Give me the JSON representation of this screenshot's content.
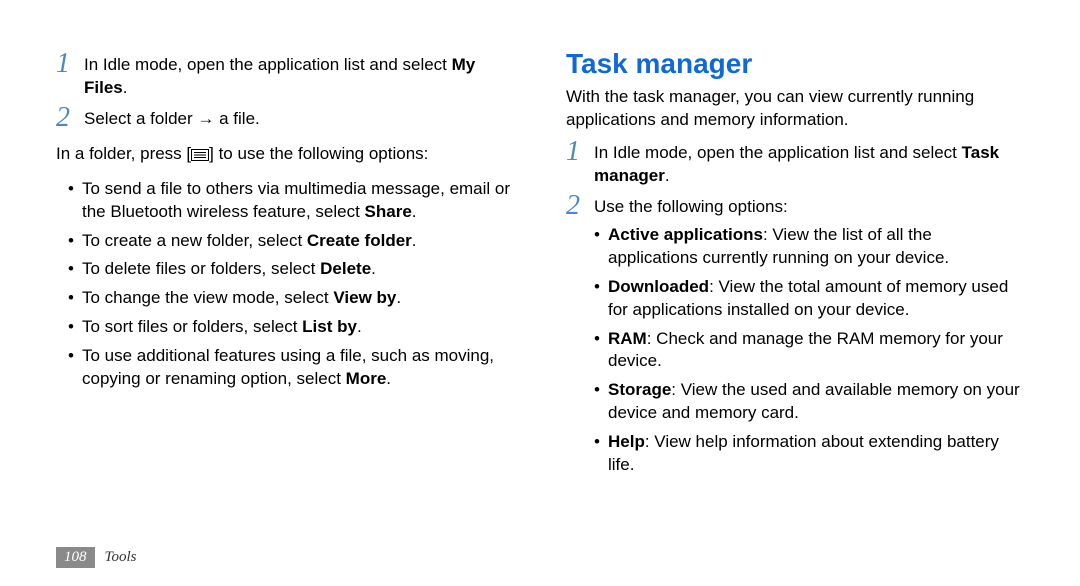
{
  "left": {
    "step1": {
      "text_a": "In Idle mode, open the application list and select ",
      "bold": "My Files",
      "text_b": "."
    },
    "step2": {
      "text_a": "Select a folder → a file."
    },
    "after_a": "In a folder, press [",
    "after_b": "] to use the following options:",
    "bullets": [
      {
        "pre": "To send a file to others via multimedia message, email or the Bluetooth wireless feature, select ",
        "bold": "Share",
        "post": "."
      },
      {
        "pre": "To create a new folder, select ",
        "bold": "Create folder",
        "post": "."
      },
      {
        "pre": "To delete files or folders, select ",
        "bold": "Delete",
        "post": "."
      },
      {
        "pre": "To change the view mode, select ",
        "bold": "View by",
        "post": "."
      },
      {
        "pre": "To sort files or folders, select ",
        "bold": "List by",
        "post": "."
      },
      {
        "pre": "To use additional features using a file, such as moving, copying or renaming option, select ",
        "bold": "More",
        "post": "."
      }
    ]
  },
  "right": {
    "title": "Task manager",
    "intro": "With the task manager, you can view currently running applications and memory information.",
    "step1": {
      "text_a": "In Idle mode, open the application list and select ",
      "bold": "Task manager",
      "text_b": "."
    },
    "step2": {
      "text_a": "Use the following options:"
    },
    "bullets": [
      {
        "bold": "Active applications",
        "post": ": View the list of all the applications currently running on your device."
      },
      {
        "bold": "Downloaded",
        "post": ": View the total amount of memory used for applications installed on your device."
      },
      {
        "bold": "RAM",
        "post": ": Check and manage the RAM memory for your device."
      },
      {
        "bold": "Storage",
        "post": ": View the used and available memory on your device and memory card."
      },
      {
        "bold": "Help",
        "post": ": View help information about extending battery life."
      }
    ]
  },
  "footer": {
    "page": "108",
    "section": "Tools"
  },
  "nums": {
    "one": "1",
    "two": "2"
  }
}
